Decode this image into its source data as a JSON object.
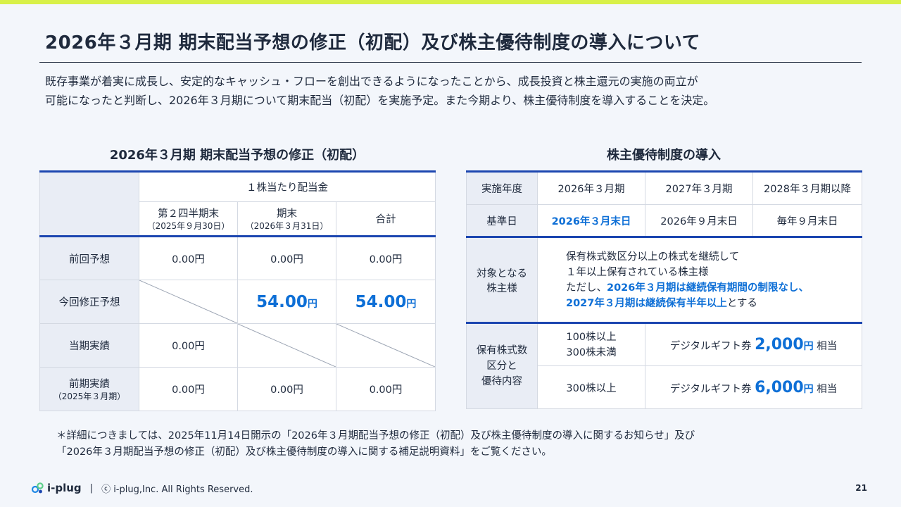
{
  "colors": {
    "accent_bar": "#d8f048",
    "primary_blue": "#0e6fd6",
    "table_border": "#1c46b0"
  },
  "title": "2026年３月期 期末配当予想の修正（初配）及び株主優待制度の導入について",
  "intro": {
    "line1": "既存事業が着実に成長し、安定的なキャッシュ・フローを創出できるようになったことから、成長投資と株主還元の実施の両立が",
    "line2": "可能になったと判断し、2026年３月期について期末配当（初配）を実施予定。また今期より、株主優待制度を導入することを決定。"
  },
  "dividend": {
    "section_title": "2026年３月期 期末配当予想の修正（初配）",
    "group_header": "１株当たり配当金",
    "columns": [
      {
        "label": "第２四半期末",
        "sub": "（2025年９月30日）"
      },
      {
        "label": "期末",
        "sub": "（2026年３月31日）"
      },
      {
        "label": "合計",
        "sub": ""
      }
    ],
    "rows": {
      "previous": {
        "label": "前回予想",
        "q2": "0.00円",
        "end": "0.00円",
        "total": "0.00円"
      },
      "revised": {
        "label": "今回修正予想",
        "end_num": "54.00",
        "end_unit": "円",
        "total_num": "54.00",
        "total_unit": "円"
      },
      "current": {
        "label": "当期実績",
        "q2": "0.00円"
      },
      "prior": {
        "label": "前期実績",
        "sub": "（2025年３月期）",
        "q2": "0.00円",
        "end": "0.00円",
        "total": "0.00円"
      }
    }
  },
  "benefits": {
    "section_title": "株主優待制度の導入",
    "year_label": "実施年度",
    "years": [
      "2026年３月期",
      "2027年３月期",
      "2028年３月期以降"
    ],
    "record_label": "基準日",
    "record_dates": [
      "2026年３月末日",
      "2026年９月末日",
      "毎年９月末日"
    ],
    "eligibility_label_1": "対象となる",
    "eligibility_label_2": "株主様",
    "eligibility": {
      "line1": "保有株式数区分以上の株式を継続して",
      "line2": "１年以上保有されている株主様",
      "line3_prefix": "ただし、",
      "line3_bold": "2026年３月期は継続保有期間の制限なし、",
      "line4_bold": "2027年３月期は継続保有半年以上",
      "line4_suffix": "とする"
    },
    "holding_label_1": "保有株式数",
    "holding_label_2": "区分と",
    "holding_label_3": "優待内容",
    "tiers": [
      {
        "range_1": "100株以上",
        "range_2": "300株未満",
        "prefix": "デジタルギフト券",
        "amount": "2,000",
        "unit": "円",
        "suffix": "相当"
      },
      {
        "range_1": "300株以上",
        "range_2": "",
        "prefix": "デジタルギフト券",
        "amount": "6,000",
        "unit": "円",
        "suffix": "相当"
      }
    ]
  },
  "footnote": {
    "line1": "＊詳細につきましては、2025年11月14日開示の「2026年３月期配当予想の修正（初配）及び株主優待制度の導入に関するお知らせ」及び",
    "line2": "「2026年３月期配当予想の修正（初配）及び株主優待制度の導入に関する補足説明資料」をご覧ください。"
  },
  "footer": {
    "logo_text": "i-plug",
    "separator": "|",
    "copyright": "ⓒ i-plug,Inc. All Rights Reserved.",
    "page_number": "21"
  }
}
